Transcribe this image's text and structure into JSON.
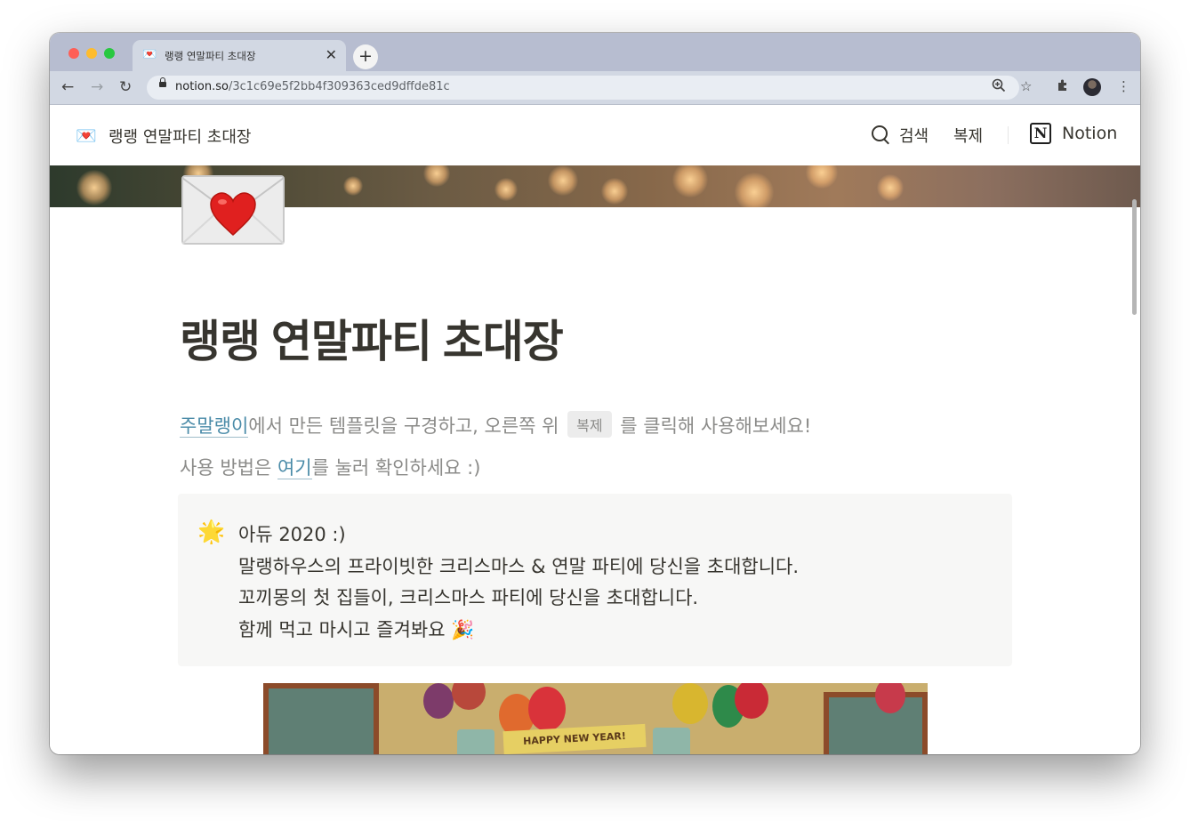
{
  "browser": {
    "tab": {
      "favicon": "💌",
      "title": "랭랭 연말파티 초대장"
    },
    "url": {
      "domain": "notion.so",
      "path": "/3c1c69e5f2bb4f309363ced9dffde81c"
    }
  },
  "topbar": {
    "icon": "💌",
    "title": "랭랭 연말파티 초대장",
    "search_label": "검색",
    "duplicate_label": "복제",
    "notion_label": "Notion",
    "notion_logo_letter": "N"
  },
  "page": {
    "icon": "envelope-with-heart",
    "title": "랭랭 연말파티 초대장",
    "intro": {
      "link_text": "주말랭이",
      "text_before_chip": "에서 만든 템플릿을 구경하고, 오른쪽 위",
      "chip": "복제",
      "text_after_chip": "를 클릭해 사용해보세요!"
    },
    "usage": {
      "text_before_link": "사용 방법은 ",
      "link_text": "여기",
      "text_after_link": "를 눌러 확인하세요 :)"
    },
    "callout": {
      "icon": "🌟",
      "lines": [
        "아듀 2020 :)",
        "말랭하우스의 프라이빗한 크리스마스 & 연말 파티에 당신을 초대합니다.",
        "꼬끼몽의 첫 집들이, 크리스마스 파티에 당신을 초대합니다.",
        "함께 먹고 마시고 즐겨봐요 🎉"
      ]
    },
    "image_banner_text": "HAPPY NEW YEAR!"
  }
}
